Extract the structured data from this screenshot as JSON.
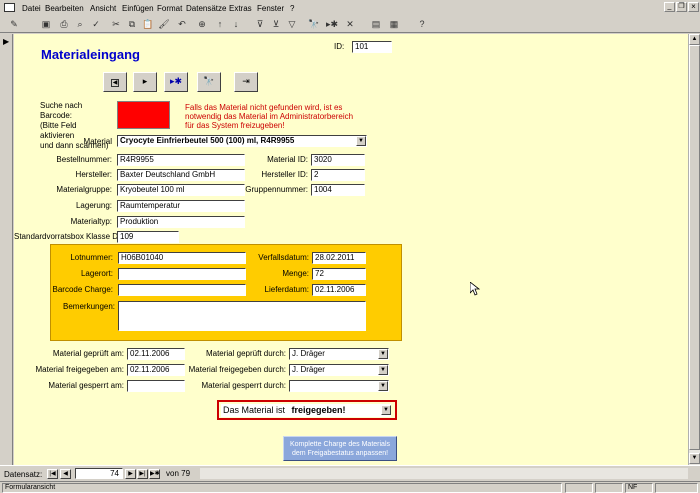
{
  "menubar": {
    "items": [
      "Datei",
      "Bearbeiten",
      "Ansicht",
      "Einfügen",
      "Format",
      "Datensätze",
      "Extras",
      "Fenster",
      "?"
    ]
  },
  "form": {
    "title": "Materialeingang",
    "id_label": "ID:",
    "id_value": "101",
    "barcode_label": "Suche nach Barcode:\n(Bitte Feld aktivieren\nund dann scannen)",
    "barcode_hint": "Falls das Material nicht gefunden wird, ist es\nnotwendig das Material im Administratorbereich\nfür das System freizugeben!",
    "material_label": "Material",
    "material_value": "Cryocyte Einfrierbeutel 500 (100) ml, R4R9955",
    "bestellnummer_label": "Bestellnummer:",
    "bestellnummer_value": "R4R9955",
    "hersteller_label": "Hersteller:",
    "hersteller_value": "Baxter Deutschland GmbH",
    "materialgruppe_label": "Materialgruppe:",
    "materialgruppe_value": "Kryobeutel 100 ml",
    "lagerung_label": "Lagerung:",
    "lagerung_value": "Raumtemperatur",
    "materialtyp_label": "Materialtyp:",
    "materialtyp_value": "Produktion",
    "standardbox_label": "Standardvorratsbox Klasse D:",
    "standardbox_value": "109",
    "material_id_label": "Material ID:",
    "material_id_value": "3020",
    "hersteller_id_label": "Hersteller ID:",
    "hersteller_id_value": "2",
    "gruppennummer_label": "Gruppennummer:",
    "gruppennummer_value": "1004",
    "lot": {
      "lotnummer_label": "Lotnummer:",
      "lotnummer_value": "H06B01040",
      "lagerort_label": "Lagerort:",
      "lagerort_value": "",
      "barcode_charge_label": "Barcode Charge:",
      "barcode_charge_value": "",
      "bemerkungen_label": "Bemerkungen:",
      "bemerkungen_value": "",
      "verfall_label": "Verfallsdatum:",
      "verfall_value": "28.02.2011",
      "menge_label": "Menge:",
      "menge_value": "72",
      "lieferdatum_label": "Lieferdatum:",
      "lieferdatum_value": "02.11.2006"
    },
    "geprueft_am_label": "Material geprüft am:",
    "geprueft_am_value": "02.11.2006",
    "freigegeben_am_label": "Material freigegeben am:",
    "freigegeben_am_value": "02.11.2006",
    "gesperrt_am_label": "Material gesperrt am:",
    "gesperrt_am_value": "",
    "geprueft_durch_label": "Material geprüft durch:",
    "geprueft_durch_value": "J. Dräger",
    "freigegeben_durch_label": "Material freigegeben durch:",
    "freigegeben_durch_value": "J. Dräger",
    "gesperrt_durch_label": "Material gesperrt durch:",
    "gesperrt_durch_value": "",
    "status_prefix": "Das Material ist",
    "status_value": "freigegeben!",
    "charge_button_label": "Komplette Charge des Materials\ndem Freigabestatus anpassen!"
  },
  "recordnav": {
    "label": "Datensatz:",
    "current": "74",
    "of_label": "von 79"
  },
  "statusbar": {
    "left": "Formularansicht",
    "nf": "NF"
  },
  "colors": {
    "form_bg": "#ffffcc",
    "lot_panel": "#ffcc00",
    "title": "#0000cc",
    "hint": "#cc0000",
    "barcode_box": "#ff0000",
    "status_border": "#cc0000",
    "charge_button": "#8ba7db"
  }
}
